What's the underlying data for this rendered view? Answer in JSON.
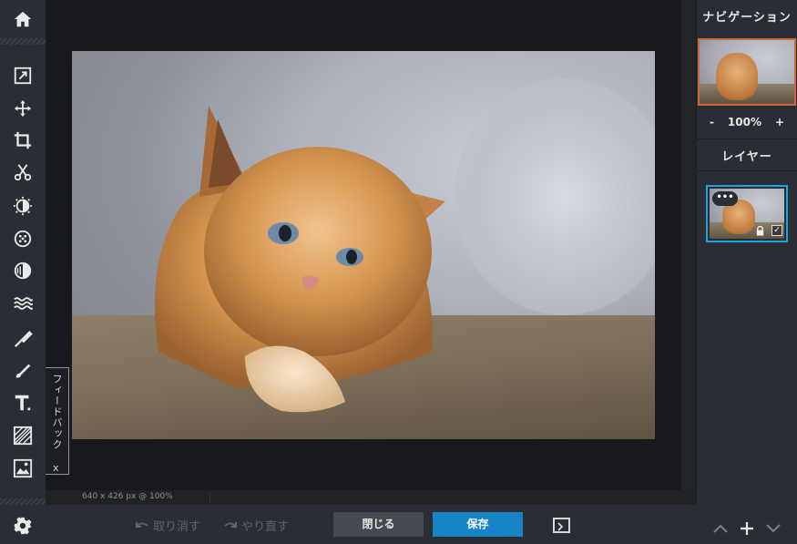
{
  "toolbar": {
    "tools": [
      "home-icon",
      "resize-icon",
      "move-icon",
      "crop-icon",
      "cut-icon",
      "adjust-icon",
      "filter-icon",
      "vignette-icon",
      "wave-icon",
      "brush-icon",
      "pencil-icon",
      "text-icon",
      "pattern-icon",
      "image-icon"
    ],
    "settings": "gear-icon"
  },
  "canvas": {
    "status": "640 x 426 px @ 100%"
  },
  "feedback": {
    "label": "フィードバック",
    "close": "x"
  },
  "navigation": {
    "title": "ナビゲーション",
    "zoom_out": "-",
    "zoom_level": "100%",
    "zoom_in": "+"
  },
  "layers": {
    "title": "レイヤー",
    "menu": "•••",
    "visible_check": "✓"
  },
  "layer_controls": {
    "up": "︿",
    "add": "+",
    "down": "﹀"
  },
  "bottom": {
    "undo": "取り消す",
    "redo": "やり直す",
    "close": "閉じる",
    "save": "保存"
  },
  "colors": {
    "accent": "#1784c5",
    "nav_border": "#d2673a",
    "layer_border": "#1aa3e0"
  }
}
